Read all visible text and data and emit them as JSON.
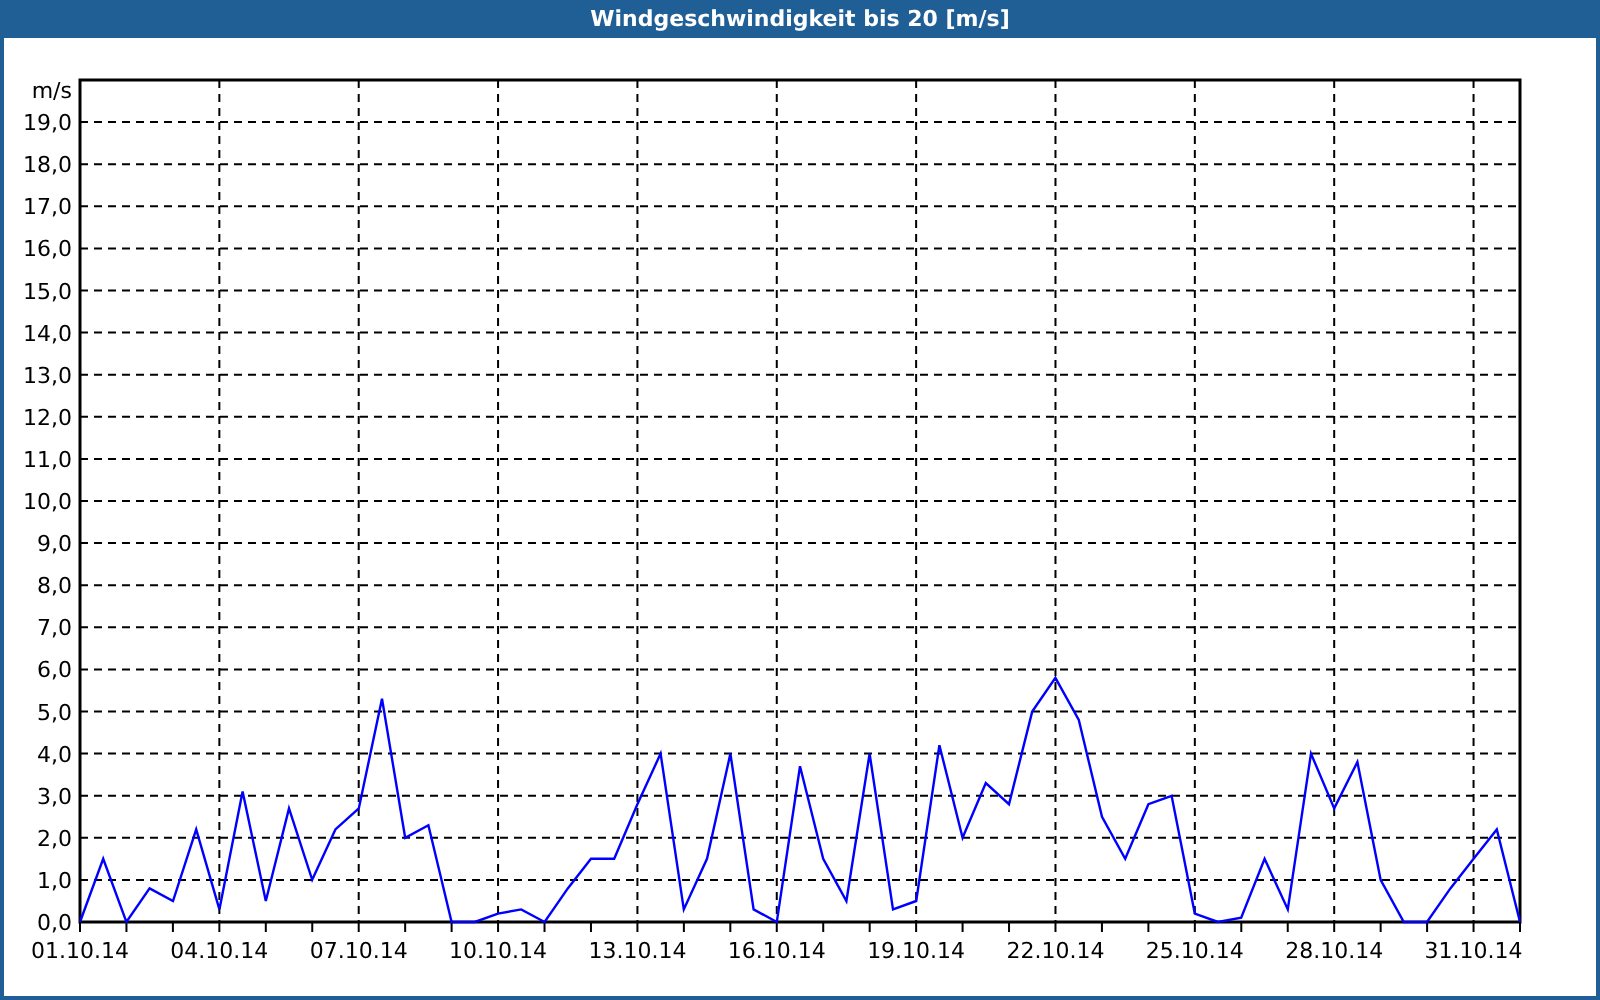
{
  "window": {
    "title": "Windgeschwindigkeit bis 20 [m/s]"
  },
  "chart_data": {
    "type": "line",
    "grid": true,
    "ylabel": "m/s",
    "ylim": [
      0,
      20
    ],
    "categories": [
      "01.10.14",
      null,
      null,
      null,
      null,
      null,
      "04.10.14",
      null,
      null,
      null,
      null,
      null,
      "07.10.14",
      null,
      null,
      null,
      null,
      null,
      "10.10.14",
      null,
      null,
      null,
      null,
      null,
      "13.10.14",
      null,
      null,
      null,
      null,
      null,
      "16.10.14",
      null,
      null,
      null,
      null,
      null,
      "19.10.14",
      null,
      null,
      null,
      null,
      null,
      "22.10.14",
      null,
      null,
      null,
      null,
      null,
      "25.10.14",
      null,
      null,
      null,
      null,
      null,
      "28.10.14",
      null,
      null,
      null,
      null,
      null,
      "31.10.14",
      null,
      null
    ],
    "yticks": [
      {
        "value": 0,
        "label": "0,0"
      },
      {
        "value": 1,
        "label": "1,0"
      },
      {
        "value": 2,
        "label": "2,0"
      },
      {
        "value": 3,
        "label": "3,0"
      },
      {
        "value": 4,
        "label": "4,0"
      },
      {
        "value": 5,
        "label": "5,0"
      },
      {
        "value": 6,
        "label": "6,0"
      },
      {
        "value": 7,
        "label": "7,0"
      },
      {
        "value": 8,
        "label": "8,0"
      },
      {
        "value": 9,
        "label": "9,0"
      },
      {
        "value": 10,
        "label": "10,0"
      },
      {
        "value": 11,
        "label": "11,0"
      },
      {
        "value": 12,
        "label": "12,0"
      },
      {
        "value": 13,
        "label": "13,0"
      },
      {
        "value": 14,
        "label": "14,0"
      },
      {
        "value": 15,
        "label": "15,0"
      },
      {
        "value": 16,
        "label": "16,0"
      },
      {
        "value": 17,
        "label": "17,0"
      },
      {
        "value": 18,
        "label": "18,0"
      },
      {
        "value": 19,
        "label": "19,0"
      }
    ],
    "series": [
      {
        "color": "#0000ff",
        "values": [
          0,
          1.5,
          0,
          0.8,
          0.5,
          2.2,
          0.3,
          3.1,
          0.5,
          2.7,
          1.0,
          2.2,
          2.7,
          5.3,
          2.0,
          2.3,
          0,
          0,
          0.2,
          0.3,
          0,
          0.8,
          1.5,
          1.5,
          2.8,
          4.0,
          0.3,
          1.5,
          4.0,
          0.3,
          0,
          3.7,
          1.5,
          0.5,
          4.0,
          0.3,
          0.5,
          4.2,
          2.0,
          3.3,
          2.8,
          5.0,
          5.8,
          4.8,
          2.5,
          1.5,
          2.8,
          3.0,
          0.2,
          0,
          0.1,
          1.5,
          0.3,
          4.0,
          2.7,
          3.8,
          1.0,
          0,
          0,
          0.8,
          1.5,
          2.2,
          0
        ]
      }
    ]
  }
}
